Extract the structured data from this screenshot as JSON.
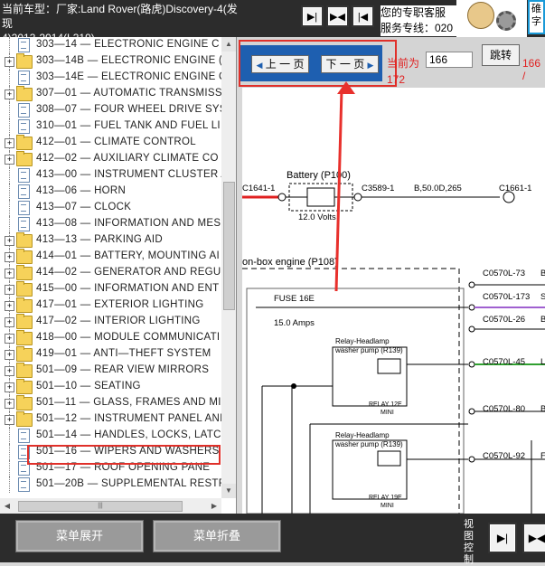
{
  "header": {
    "vehicle_line1": "当前车型：厂家:Land Rover(路虎)Discovery-4(发现",
    "vehicle_line2": "4)2013-2014(L319)",
    "service_line1": "您的专职客服",
    "service_line2": "服务专线：020",
    "mascot_text_1": "碓",
    "mascot_text_2": "字",
    "nav_icons": [
      "arrow-right-icon",
      "arrows-both-icon",
      "arrow-left-icon"
    ]
  },
  "tree": {
    "selected_index": 26,
    "items": [
      {
        "label": "303—14 — ELECTRONIC ENGINE C",
        "kind": "doc",
        "expandable": false
      },
      {
        "label": "303—14B — ELECTRONIC ENGINE (",
        "kind": "folder",
        "expandable": true
      },
      {
        "label": "303—14E — ELECTRONIC ENGINE C",
        "kind": "doc",
        "expandable": false
      },
      {
        "label": "307—01 — AUTOMATIC TRANSMISS",
        "kind": "folder",
        "expandable": true
      },
      {
        "label": "308—07 — FOUR WHEEL DRIVE SYS",
        "kind": "doc",
        "expandable": false
      },
      {
        "label": "310—01 — FUEL TANK AND FUEL LI",
        "kind": "doc",
        "expandable": false
      },
      {
        "label": "412—01 — CLIMATE CONTROL",
        "kind": "folder",
        "expandable": true
      },
      {
        "label": "412—02 — AUXILIARY CLIMATE CO",
        "kind": "folder",
        "expandable": true
      },
      {
        "label": "413—00 — INSTRUMENT CLUSTER A",
        "kind": "doc",
        "expandable": false
      },
      {
        "label": "413—06 — HORN",
        "kind": "doc",
        "expandable": false
      },
      {
        "label": "413—07 — CLOCK",
        "kind": "doc",
        "expandable": false
      },
      {
        "label": "413—08 — INFORMATION AND MES",
        "kind": "doc",
        "expandable": false
      },
      {
        "label": "413—13 — PARKING AID",
        "kind": "folder",
        "expandable": true
      },
      {
        "label": "414—01 — BATTERY, MOUNTING AI",
        "kind": "folder",
        "expandable": true
      },
      {
        "label": "414—02 — GENERATOR AND REGU",
        "kind": "folder",
        "expandable": true
      },
      {
        "label": "415—00 — INFORMATION AND ENT",
        "kind": "folder",
        "expandable": true
      },
      {
        "label": "417—01 — EXTERIOR LIGHTING",
        "kind": "folder",
        "expandable": true
      },
      {
        "label": "417—02 — INTERIOR LIGHTING",
        "kind": "folder",
        "expandable": true
      },
      {
        "label": "418—00 — MODULE COMMUNICATI",
        "kind": "folder",
        "expandable": true
      },
      {
        "label": "419—01 — ANTI—THEFT SYSTEM",
        "kind": "folder",
        "expandable": true
      },
      {
        "label": "501—09 — REAR VIEW MIRRORS",
        "kind": "folder",
        "expandable": true
      },
      {
        "label": "501—10 — SEATING",
        "kind": "folder",
        "expandable": true
      },
      {
        "label": "501—11 — GLASS, FRAMES AND MI",
        "kind": "folder",
        "expandable": true
      },
      {
        "label": "501—12 — INSTRUMENT PANEL ANI",
        "kind": "folder",
        "expandable": true
      },
      {
        "label": "501—14 — HANDLES, LOCKS, LATC",
        "kind": "doc",
        "expandable": false
      },
      {
        "label": "501—16 — WIPERS AND WASHERS",
        "kind": "doc",
        "expandable": false
      },
      {
        "label": "501—17 — ROOF OPENING PANE",
        "kind": "doc",
        "expandable": false
      },
      {
        "label": "501—20B — SUPPLEMENTAL RESTR",
        "kind": "doc",
        "expandable": false
      }
    ]
  },
  "toolbar": {
    "prev_label": "上 一 页",
    "next_label": "下 一 页",
    "current_label": "当前为",
    "page_value": "166",
    "go_label": "跳转",
    "total_label": "166 /",
    "second_num": "172"
  },
  "diagram": {
    "battery_title": "Battery (P100)",
    "battery_volts": "12.0 Volts",
    "c1641": "C1641-1",
    "c3589": "C3589-1",
    "b_label": "B,50.0D,265",
    "c1661": "C1661-1",
    "box_title": "on-box engine (P108)",
    "fuse_label": "FUSE 16E",
    "fuse_amps": "15.0 Amps",
    "relay1_title": "Relay-Headlamp",
    "relay1_sub": "washer pump (R139)",
    "relay1_foot1": "RELAY 12E",
    "relay1_foot2": "MINI",
    "relay2_title": "Relay-Headlamp",
    "relay2_sub": "washer pump (R139)",
    "relay2_foot1": "RELAY 19E",
    "relay2_foot2": "MINI",
    "connectors": [
      {
        "label": "C0570L-73",
        "suffix": "B"
      },
      {
        "label": "C0570L-173",
        "suffix": "S"
      },
      {
        "label": "C0570L-26",
        "suffix": "B"
      },
      {
        "label": "C0570L-45",
        "suffix": "L"
      },
      {
        "label": "C0570L-80",
        "suffix": "B"
      },
      {
        "label": "C0570L-92",
        "suffix": "F"
      }
    ]
  },
  "footer": {
    "expand_label": "菜单展开",
    "collapse_label": "菜单折叠",
    "view_label": "视图控制",
    "view_icons": [
      "arrow-right-icon",
      "arrows-both-icon"
    ]
  },
  "colors": {
    "highlight_box": "#e0302a",
    "nav_panel": "#1e5fb0",
    "selection": "#3b74c9",
    "red_text": "#e02020"
  }
}
